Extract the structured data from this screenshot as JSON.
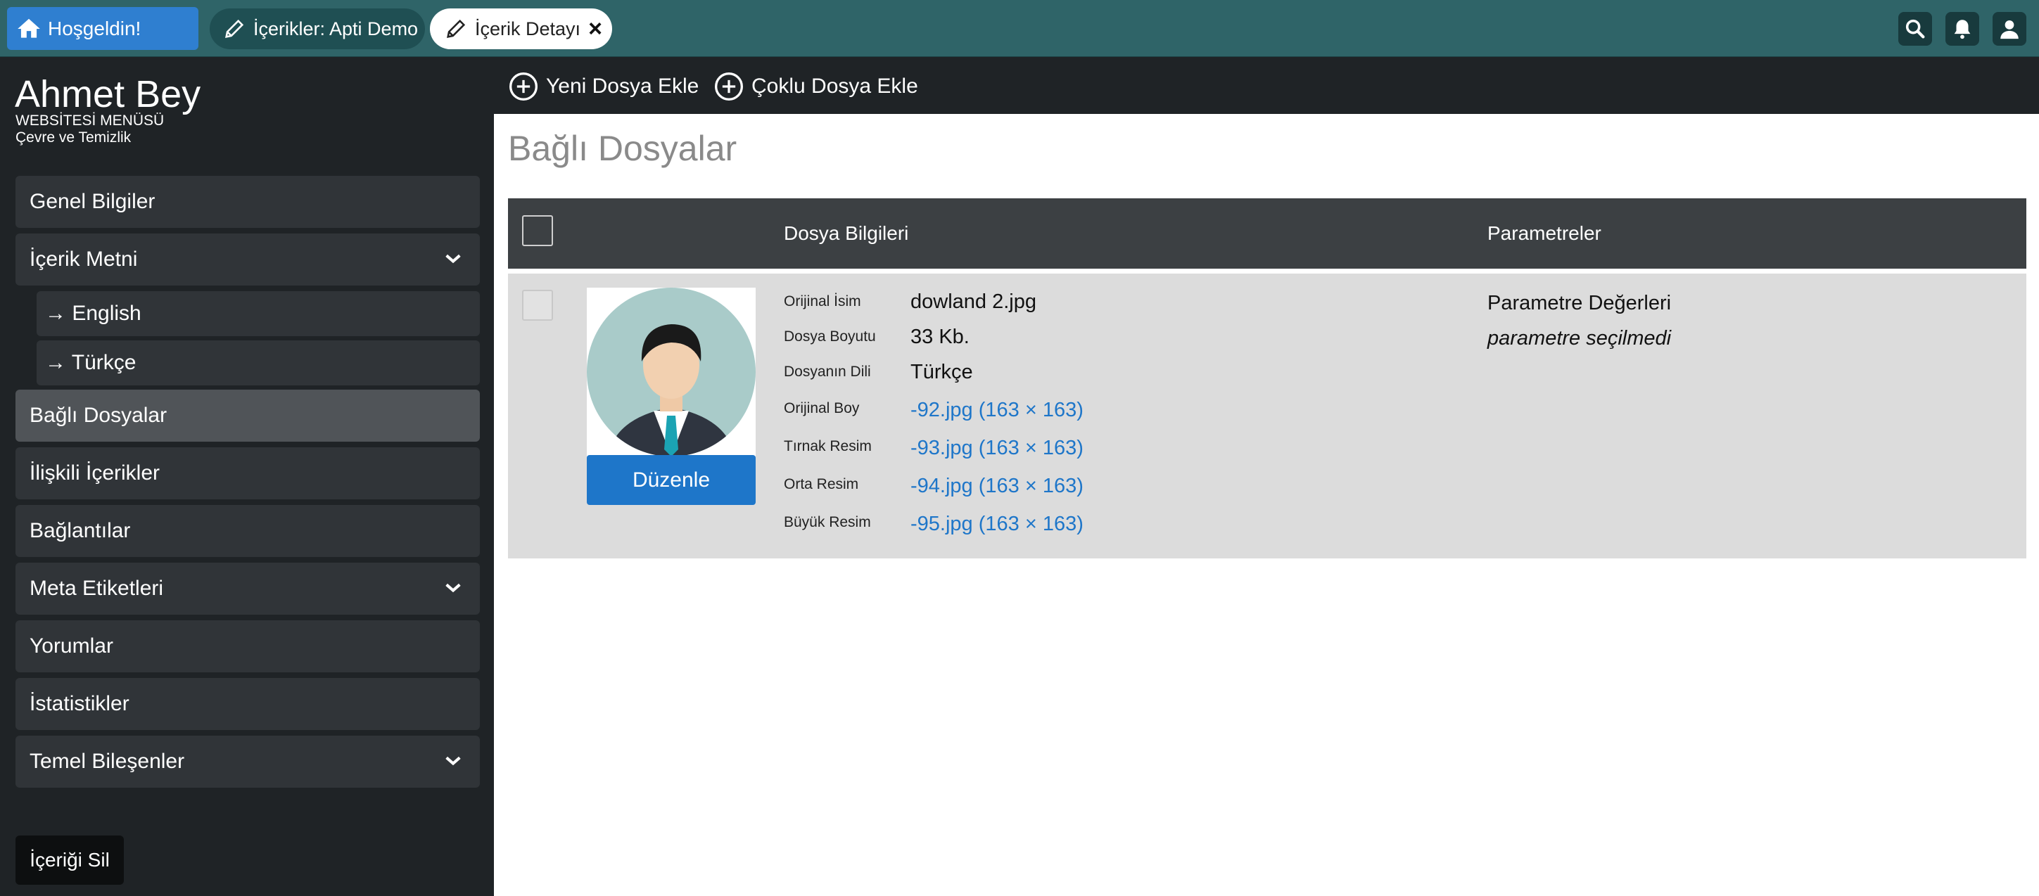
{
  "topbar": {
    "home_tab": "Hoşgeldin!",
    "tabs": [
      {
        "label": "İçerikler: Apti Demo"
      },
      {
        "label": "İçerik Detayı"
      }
    ],
    "icons": [
      "search-icon",
      "bell-icon",
      "user-icon"
    ]
  },
  "sidebar": {
    "user_name": "Ahmet Bey",
    "menu_title": "WEBSİTESİ MENÜSÜ",
    "menu_sub": "Çevre ve Temizlik",
    "items": [
      {
        "label": "Genel Bilgiler"
      },
      {
        "label": "İçerik Metni",
        "expandable": true
      },
      {
        "label": "→ English",
        "sub": true
      },
      {
        "label": "→ Türkçe",
        "sub": true
      },
      {
        "label": "Bağlı Dosyalar",
        "active": true
      },
      {
        "label": "İlişkili İçerikler"
      },
      {
        "label": "Bağlantılar"
      },
      {
        "label": "Meta Etiketleri",
        "expandable": true
      },
      {
        "label": "Yorumlar"
      },
      {
        "label": "İstatistikler"
      },
      {
        "label": "Temel Bileşenler",
        "expandable": true
      }
    ],
    "delete_label": "İçeriği Sil"
  },
  "toolbar": {
    "add_file": "Yeni Dosya Ekle",
    "add_multi": "Çoklu Dosya Ekle"
  },
  "main": {
    "title": "Bağlı Dosyalar",
    "columns": [
      "Dosya Bilgileri",
      "Parametreler"
    ],
    "file": {
      "edit_label": "Düzenle",
      "fields": [
        {
          "label": "Orijinal İsim",
          "value": "dowland 2.jpg",
          "link": false
        },
        {
          "label": "Dosya Boyutu",
          "value": "33 Kb.",
          "link": false
        },
        {
          "label": "Dosyanın Dili",
          "value": "Türkçe",
          "link": false
        },
        {
          "label": "Orijinal Boy",
          "value": "-92.jpg (163 × 163)",
          "link": true
        },
        {
          "label": "Tırnak Resim",
          "value": "-93.jpg (163 × 163)",
          "link": true
        },
        {
          "label": "Orta Resim",
          "value": "-94.jpg (163 × 163)",
          "link": true
        },
        {
          "label": "Büyük Resim",
          "value": "-95.jpg (163 × 163)",
          "link": true
        }
      ],
      "param_title": "Parametre Değerleri",
      "param_value": "parametre seçilmedi"
    }
  },
  "colors": {
    "topbar": "#2f6468",
    "accent": "#1e76c9",
    "sidebar": "#1f2326"
  }
}
